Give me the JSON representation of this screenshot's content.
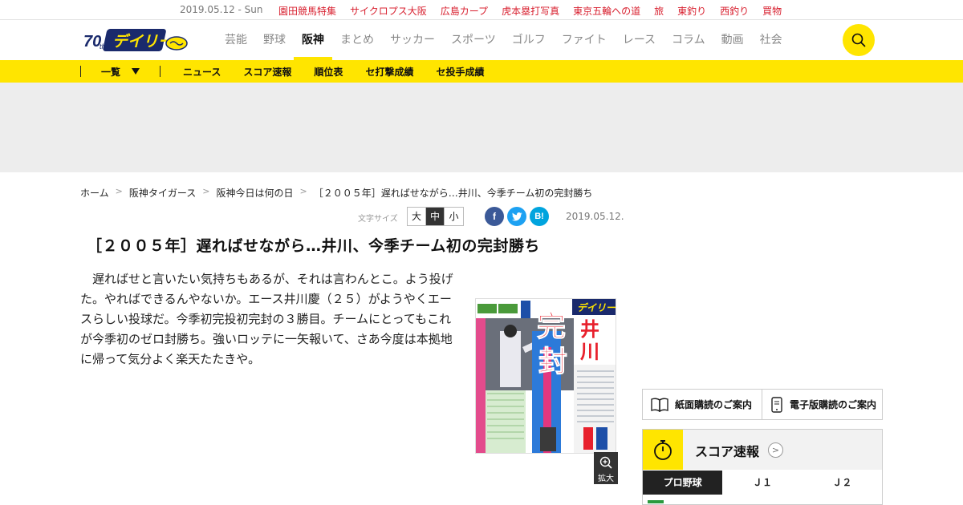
{
  "topbar": {
    "date": "2019.05.12 - Sun",
    "links": [
      "園田競馬特集",
      "サイクロプス大阪",
      "広島カープ",
      "虎本塁打写真",
      "東京五輪への道",
      "旅",
      "東釣り",
      "西釣り",
      "買物"
    ]
  },
  "header": {
    "logo_text": "デイリー",
    "logo_badge": "70th",
    "nav": [
      {
        "label": "芸能",
        "active": false
      },
      {
        "label": "野球",
        "active": false
      },
      {
        "label": "阪神",
        "active": true
      },
      {
        "label": "まとめ",
        "active": false
      },
      {
        "label": "サッカー",
        "active": false
      },
      {
        "label": "スポーツ",
        "active": false
      },
      {
        "label": "ゴルフ",
        "active": false
      },
      {
        "label": "ファイト",
        "active": false
      },
      {
        "label": "レース",
        "active": false
      },
      {
        "label": "コラム",
        "active": false
      },
      {
        "label": "動画",
        "active": false
      },
      {
        "label": "社会",
        "active": false
      }
    ]
  },
  "subnav": {
    "dropdown_label": "一覧",
    "items": [
      "ニュース",
      "スコア速報",
      "順位表",
      "セ打撃成績",
      "セ投手成績"
    ]
  },
  "breadcrumb": [
    "ホーム",
    "阪神タイガース",
    "阪神今日は何の日",
    "［２００５年］遅ればせながら…井川、今季チーム初の完封勝ち"
  ],
  "article": {
    "font_size_label": "文字サイズ",
    "font_sizes": [
      "大",
      "中",
      "小"
    ],
    "selected_font_size": "中",
    "date": "2019.05.12.",
    "title": "［２００５年］遅ればせながら…井川、今季チーム初の完封勝ち",
    "body": "遅ればせと言いたい気持ちもあるが、それは言わんとこ。よう投げた。やればできるんやないか。エース井川慶（２５）がようやくエースらしい投球だ。今季初完投初完封の３勝目。チームにとってもこれが今季初のゼロ封勝ち。強いロッテに一矢報いて、さあ今度は本拠地に帰って気分よく楽天たたきや。",
    "image": {
      "headline_big": [
        "完",
        "封"
      ],
      "headline_name": [
        "井",
        "川"
      ],
      "zoom_label": "拡大"
    }
  },
  "sidebar": {
    "subscribe": [
      "紙面購読のご案内",
      "電子版購読のご案内"
    ],
    "score": {
      "title": "スコア速報",
      "tabs": [
        "プロ野球",
        "Ｊ１",
        "Ｊ２"
      ],
      "selected_tab": "プロ野球"
    }
  },
  "colors": {
    "accent_yellow": "#ffe500",
    "topbar_link": "#d8202f",
    "ad_band": "#ededed",
    "facebook": "#3b5998",
    "twitter": "#1da1f2",
    "hatena": "#00a4de"
  }
}
